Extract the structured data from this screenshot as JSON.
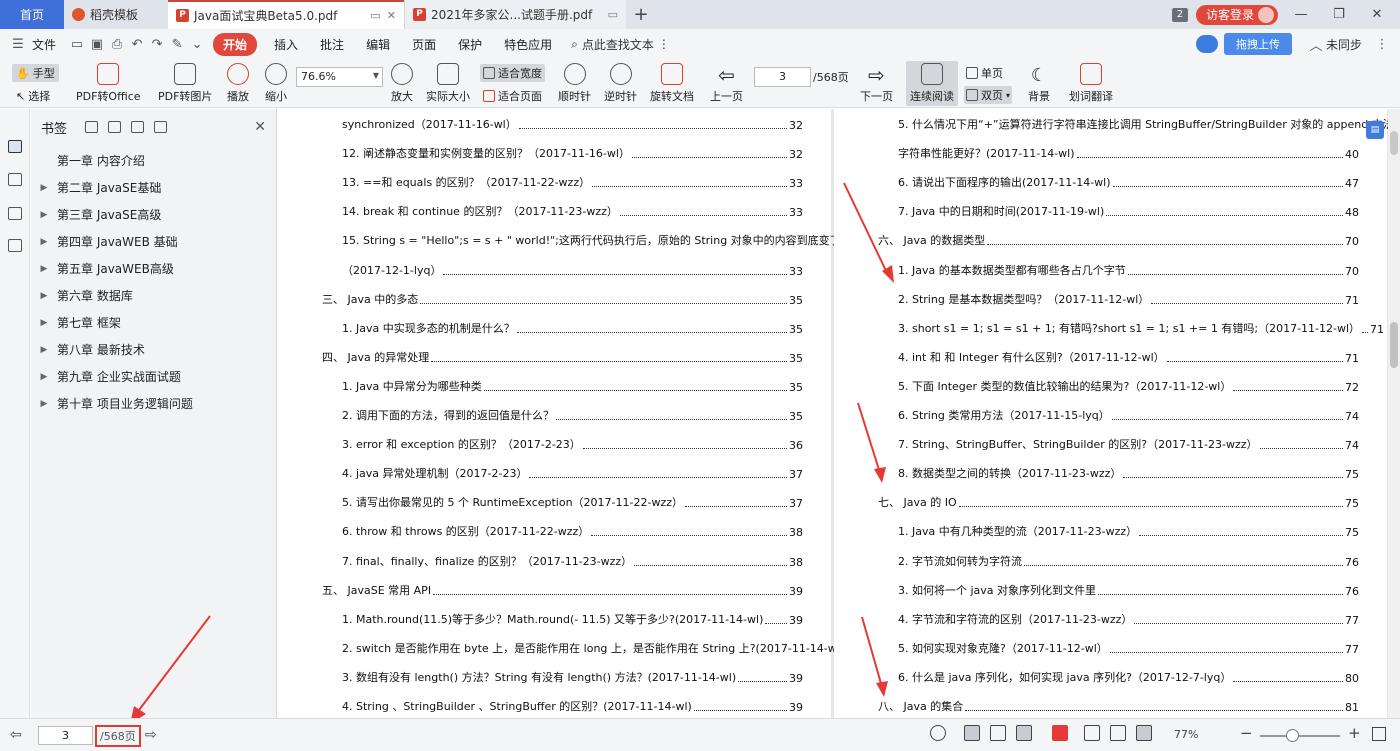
{
  "tabs": {
    "home": "首页",
    "daoke": "稻壳模板",
    "active_doc": "Java面试宝典Beta5.0.pdf",
    "second_doc": "2021年多家公...试题手册.pdf",
    "count_badge": "2",
    "visitor_login": "访客登录"
  },
  "menu": {
    "file": "文件",
    "start": "开始",
    "insert": "插入",
    "annotate": "批注",
    "edit": "编辑",
    "page": "页面",
    "protect": "保护",
    "features": "特色应用",
    "search_text": "点此查找文本",
    "upload": "拖拽上传",
    "sync": "未同步"
  },
  "toolbar": {
    "hand": "手型",
    "select": "选择",
    "pdf_to_office": "PDF转Office",
    "pdf_to_image": "PDF转图片",
    "play": "播放",
    "zoom_out": "缩小",
    "zoom_value": "76.6%",
    "zoom_in": "放大",
    "actual_size": "实际大小",
    "fit_width": "适合宽度",
    "fit_page": "适合页面",
    "rotate_cw": "顺时针",
    "rotate_ccw": "逆时针",
    "rotate_doc": "旋转文档",
    "prev_page": "上一页",
    "current_page": "3",
    "total_pages": "/568页",
    "next_page": "下一页",
    "continuous": "连续阅读",
    "single": "单页",
    "double": "双页",
    "background": "背景",
    "translate": "划词翻译"
  },
  "bookmarks": {
    "title": "书签",
    "items": [
      {
        "label": "第一章 内容介绍",
        "expandable": false
      },
      {
        "label": "第二章 JavaSE基础",
        "expandable": true
      },
      {
        "label": "第三章 JavaSE高级",
        "expandable": true
      },
      {
        "label": "第四章 JavaWEB 基础",
        "expandable": true
      },
      {
        "label": "第五章 JavaWEB高级",
        "expandable": true
      },
      {
        "label": "第六章 数据库",
        "expandable": true
      },
      {
        "label": "第七章 框架",
        "expandable": true
      },
      {
        "label": "第八章 最新技术",
        "expandable": true
      },
      {
        "label": "第九章 企业实战面试题",
        "expandable": true
      },
      {
        "label": "第十章 项目业务逻辑问题",
        "expandable": true
      }
    ]
  },
  "toc_left": [
    {
      "text": "synchronized（2017-11-16-wl）",
      "page": "32"
    },
    {
      "text": "12. 阐述静态变量和实例变量的区别？（2017-11-16-wl）",
      "page": "32"
    },
    {
      "text": "13. ==和 equals 的区别？（2017-11-22-wzz）",
      "page": "33"
    },
    {
      "text": "14. break 和 continue 的区别？（2017-11-23-wzz）",
      "page": "33"
    },
    {
      "text": "15. String s = \"Hello\";s = s + \" world!\";这两行代码执行后，原始的 String 对象中的内容到底变了没有？",
      "page": ""
    },
    {
      "text": "（2017-12-1-lyq）",
      "page": "33"
    },
    {
      "text": "三、 Java 中的多态",
      "page": "35"
    },
    {
      "text": "1. Java 中实现多态的机制是什么？",
      "page": "35"
    },
    {
      "text": "四、 Java 的异常处理",
      "page": "35"
    },
    {
      "text": "1. Java 中异常分为哪些种类",
      "page": "35"
    },
    {
      "text": "2. 调用下面的方法，得到的返回值是什么？",
      "page": "35"
    },
    {
      "text": "3. error 和 exception 的区别？（2017-2-23）",
      "page": "36"
    },
    {
      "text": "4. java 异常处理机制（2017-2-23）",
      "page": "37"
    },
    {
      "text": "5. 请写出你最常见的 5 个 RuntimeException（2017-11-22-wzz）",
      "page": "37"
    },
    {
      "text": "6. throw 和 throws 的区别（2017-11-22-wzz）",
      "page": "38"
    },
    {
      "text": "7. final、finally、finalize 的区别？（2017-11-23-wzz）",
      "page": "38"
    },
    {
      "text": "五、 JavaSE 常用 API",
      "page": "39"
    },
    {
      "text": "1. Math.round(11.5)等于多少？Math.round(- 11.5) 又等于多少?(2017-11-14-wl)",
      "page": "39"
    },
    {
      "text": "2. switch 是否能作用在 byte 上，是否能作用在 long 上，是否能作用在 String 上?(2017-11-14-wl)",
      "page": "39"
    },
    {
      "text": "3. 数组有没有 length() 方法？String 有没有 length() 方法？(2017-11-14-wl)",
      "page": "39"
    },
    {
      "text": "4. String 、StringBuilder 、StringBuffer 的区别？(2017-11-14-wl)",
      "page": "39"
    }
  ],
  "toc_right": [
    {
      "text": "5. 什么情况下用“+”运算符进行字符串连接比调用 StringBuffer/StringBuilder 对象的 append 方法连接",
      "page": ""
    },
    {
      "text": "字符串性能更好？(2017-11-14-wl)",
      "page": "40"
    },
    {
      "text": "6. 请说出下面程序的输出(2017-11-14-wl)",
      "page": "47"
    },
    {
      "text": "7. Java 中的日期和时间(2017-11-19-wl)",
      "page": "48"
    },
    {
      "text": "六、 Java 的数据类型",
      "page": "70"
    },
    {
      "text": "1. Java 的基本数据类型都有哪些各占几个字节",
      "page": "70"
    },
    {
      "text": "2. String 是基本数据类型吗？（2017-11-12-wl）",
      "page": "71"
    },
    {
      "text": "3. short s1 = 1; s1 = s1 + 1; 有错吗?short s1 = 1; s1 += 1 有错吗;（2017-11-12-wl）",
      "page": "71"
    },
    {
      "text": "4. int 和 和 Integer 有什么区别?（2017-11-12-wl）",
      "page": "71"
    },
    {
      "text": "5. 下面 Integer 类型的数值比较输出的结果为?（2017-11-12-wl）",
      "page": "72"
    },
    {
      "text": "6. String 类常用方法（2017-11-15-lyq）",
      "page": "74"
    },
    {
      "text": "7. String、StringBuffer、StringBuilder 的区别?（2017-11-23-wzz）",
      "page": "74"
    },
    {
      "text": "8. 数据类型之间的转换（2017-11-23-wzz）",
      "page": "75"
    },
    {
      "text": "七、 Java 的 IO",
      "page": "75"
    },
    {
      "text": "1. Java 中有几种类型的流（2017-11-23-wzz）",
      "page": "75"
    },
    {
      "text": "2. 字节流如何转为字符流",
      "page": "76"
    },
    {
      "text": "3. 如何将一个 java 对象序列化到文件里",
      "page": "76"
    },
    {
      "text": "4. 字节流和字符流的区别（2017-11-23-wzz）",
      "page": "77"
    },
    {
      "text": "5. 如何实现对象克隆?（2017-11-12-wl）",
      "page": "77"
    },
    {
      "text": "6. 什么是 java 序列化，如何实现 java 序列化?（2017-12-7-lyq）",
      "page": "80"
    },
    {
      "text": "八、 Java 的集合",
      "page": "81"
    }
  ],
  "status": {
    "page": "3",
    "total": "/568页",
    "zoom": "77%"
  },
  "colors": {
    "accent_red": "#e0483d",
    "home_tab_blue": "#3f6fd8",
    "annotation_red": "#e53935"
  }
}
